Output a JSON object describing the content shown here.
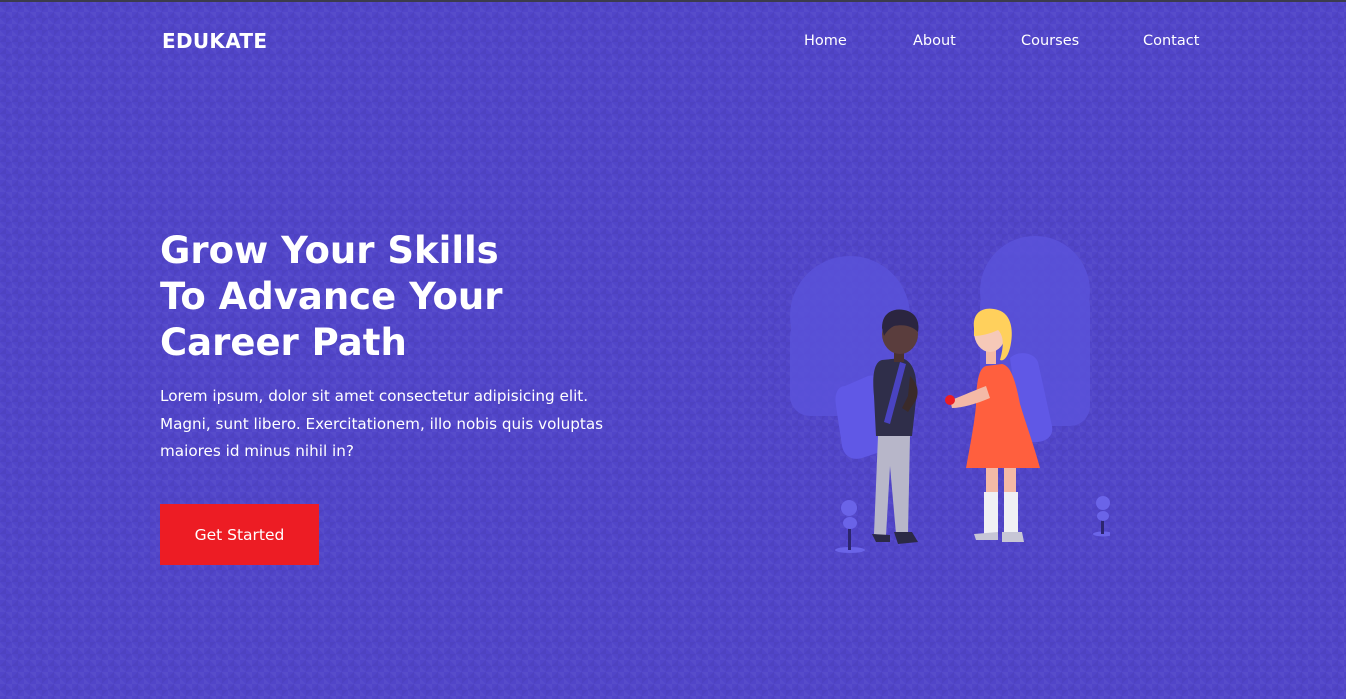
{
  "brand": {
    "name": "EDUKATE"
  },
  "nav": {
    "home": "Home",
    "about": "About",
    "courses": "Courses",
    "contact": "Contact"
  },
  "hero": {
    "title_lines": [
      "Grow Your Skills",
      "To Advance Your",
      "Career Path"
    ],
    "description": "Lorem ipsum, dolor sit amet consectetur adipisicing elit. Magni, sunt libero. Exercitationem, illo nobis quis voluptas maiores id minus nihil in?",
    "cta_label": "Get Started"
  },
  "colors": {
    "background": "#5145c9",
    "cta": "#ed1c24",
    "text": "#ffffff"
  }
}
